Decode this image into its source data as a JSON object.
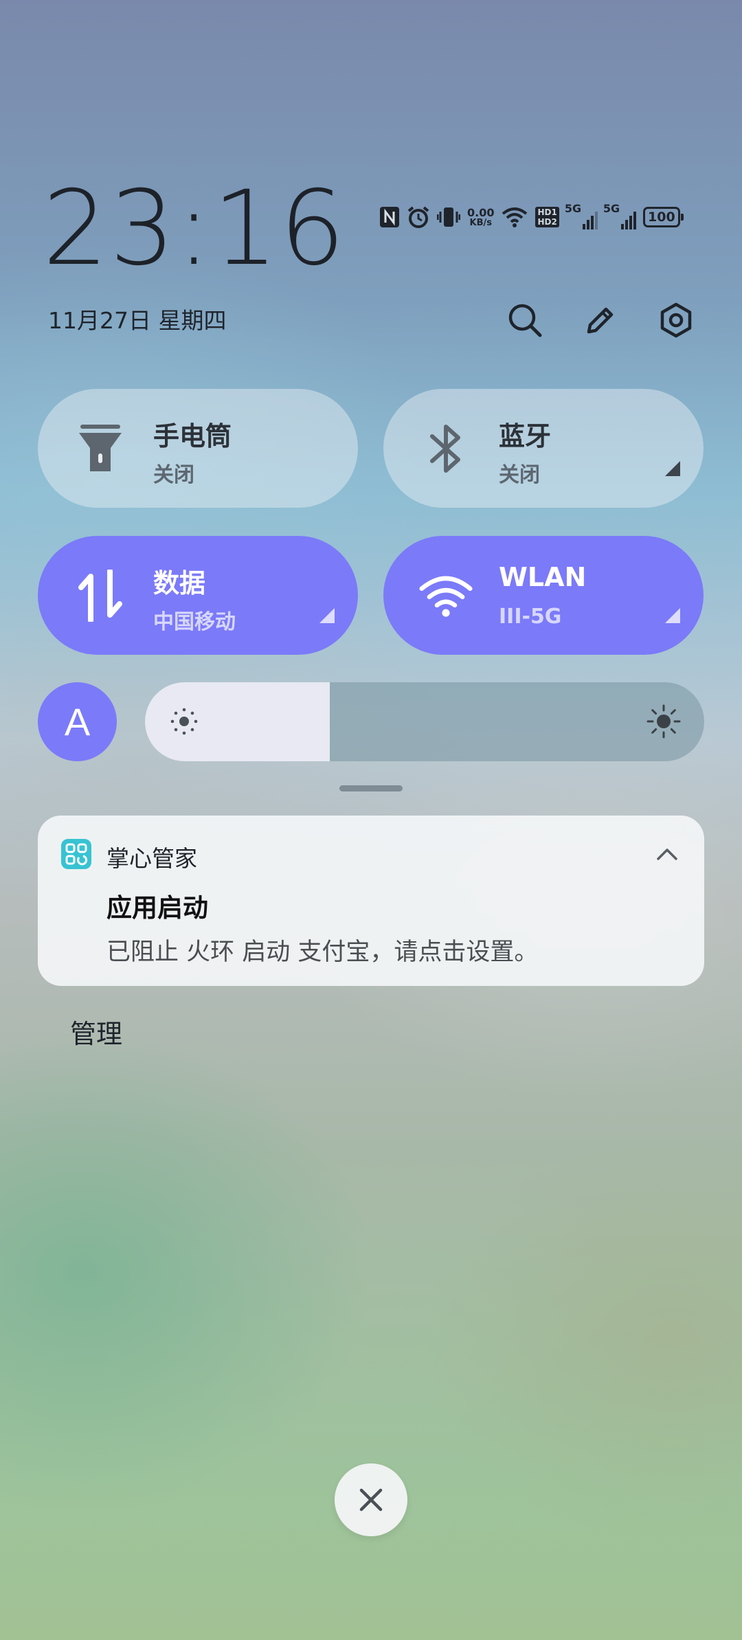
{
  "clock": {
    "time": "23:16",
    "date": "11月27日 星期四"
  },
  "status_bar": {
    "net_speed_value": "0.00",
    "net_speed_unit": "KB/s",
    "hd_top": "HD1",
    "hd_bottom": "HD2",
    "sim1_tag": "5G",
    "sim2_tag": "5G",
    "battery": "100",
    "icons": [
      "nfc-icon",
      "alarm-icon",
      "vibrate-icon",
      "wifi-icon",
      "hd-voice-icon",
      "signal-icon",
      "signal-icon",
      "battery-icon"
    ]
  },
  "top_actions": [
    "search-icon",
    "edit-icon",
    "settings-icon"
  ],
  "tiles": [
    {
      "title": "手电筒",
      "sub": "关闭",
      "state": "off",
      "icon": "flashlight-icon"
    },
    {
      "title": "蓝牙",
      "sub": "关闭",
      "state": "off",
      "icon": "bluetooth-icon"
    },
    {
      "title": "数据",
      "sub": "中国移动",
      "state": "on",
      "icon": "mobile-data-icon"
    },
    {
      "title": "WLAN",
      "sub": "III-5G",
      "state": "on",
      "icon": "wifi-icon"
    }
  ],
  "brightness": {
    "auto_label": "A",
    "level": 0.33
  },
  "notification": {
    "app_name": "掌心管家",
    "title": "应用启动",
    "body": "已阻止 火环 启动 支付宝，请点击设置。"
  },
  "manage_label": "管理",
  "colors": {
    "accent": "#7b7af9",
    "text_dark": "#1f242b"
  }
}
